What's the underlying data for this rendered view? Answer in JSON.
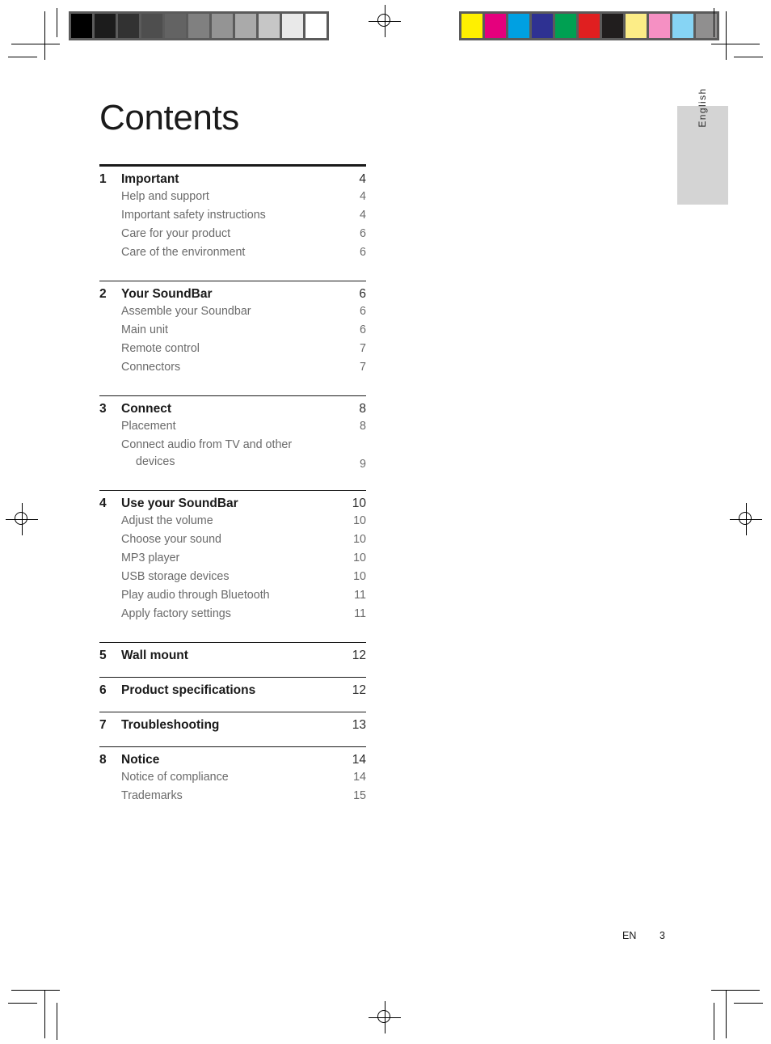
{
  "page": {
    "title": "Contents",
    "language_tab": "English",
    "footer": {
      "locale": "EN",
      "page_number": "3"
    }
  },
  "calibration": {
    "grayscale_strip": {
      "name": "grayscale-calibration-strip",
      "border_color": "#5b5b5b",
      "swatches": [
        "#000000",
        "#1c1c1c",
        "#323232",
        "#4e4e4e",
        "#636363",
        "#808080",
        "#949494",
        "#aaaaaa",
        "#c6c6c6",
        "#e9e9e9",
        "#ffffff"
      ]
    },
    "color_strip": {
      "name": "color-calibration-strip",
      "border_color": "#5b5b5b",
      "swatches": [
        "#fff000",
        "#e5007d",
        "#00a0e2",
        "#2e3192",
        "#00a052",
        "#e01f20",
        "#211e1e",
        "#fced87",
        "#f590c3",
        "#86d4f4",
        "#908f8f"
      ]
    }
  },
  "toc": {
    "sections": [
      {
        "number": "1",
        "label": "Important",
        "page": "4",
        "rule": "thick",
        "items": [
          {
            "label": "Help and support",
            "page": "4"
          },
          {
            "label": "Important safety instructions",
            "page": "4"
          },
          {
            "label": "Care for your product",
            "page": "6"
          },
          {
            "label": "Care of the environment",
            "page": "6"
          }
        ]
      },
      {
        "number": "2",
        "label": "Your SoundBar",
        "page": "6",
        "rule": "thin",
        "items": [
          {
            "label": "Assemble your Soundbar",
            "page": "6"
          },
          {
            "label": "Main unit",
            "page": "6"
          },
          {
            "label": "Remote control",
            "page": "7"
          },
          {
            "label": "Connectors",
            "page": "7"
          }
        ]
      },
      {
        "number": "3",
        "label": "Connect",
        "page": "8",
        "rule": "thin",
        "items": [
          {
            "label": "Placement",
            "page": "8"
          },
          {
            "label": "Connect audio from TV and other",
            "label2": "devices",
            "page": "9"
          }
        ]
      },
      {
        "number": "4",
        "label": "Use your SoundBar",
        "page": "10",
        "rule": "thin",
        "items": [
          {
            "label": "Adjust the volume",
            "page": "10"
          },
          {
            "label": "Choose your sound",
            "page": "10"
          },
          {
            "label": "MP3 player",
            "page": "10"
          },
          {
            "label": "USB storage devices",
            "page": "10"
          },
          {
            "label": "Play audio through Bluetooth",
            "page": "11"
          },
          {
            "label": "Apply factory settings",
            "page": "11"
          }
        ]
      },
      {
        "number": "5",
        "label": "Wall mount",
        "page": "12",
        "rule": "thin",
        "items": []
      },
      {
        "number": "6",
        "label": "Product specifications",
        "page": "12",
        "rule": "thin",
        "items": []
      },
      {
        "number": "7",
        "label": "Troubleshooting",
        "page": "13",
        "rule": "thin",
        "items": []
      },
      {
        "number": "8",
        "label": "Notice",
        "page": "14",
        "rule": "thin",
        "items": [
          {
            "label": "Notice of compliance",
            "page": "14"
          },
          {
            "label": "Trademarks",
            "page": "15"
          }
        ]
      }
    ]
  }
}
